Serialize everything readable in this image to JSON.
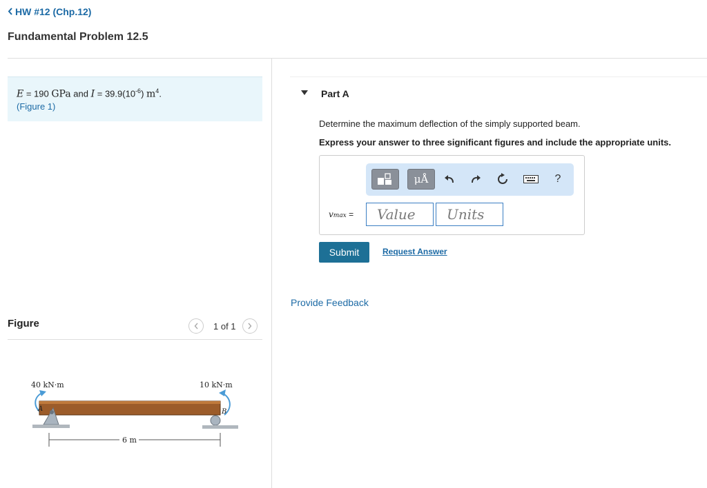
{
  "nav": {
    "back_label": "HW #12 (Chp.12)"
  },
  "page_title": "Fundamental Problem 12.5",
  "given": {
    "E_symbol": "E",
    "eq1": " = 190 ",
    "E_unit": "GPa",
    "and": " and ",
    "I_symbol": "I",
    "eq2": " = 39.9(10",
    "exp1": "-6",
    "close_paren": ") ",
    "I_unit": "m",
    "exp2": "4",
    "period": ".",
    "figure_link": "(Figure 1)"
  },
  "figure_panel": {
    "heading": "Figure",
    "pager_text": "1 of 1",
    "labels": {
      "left_moment": "40 kN·m",
      "right_moment": "10 kN·m",
      "support_a": "A",
      "support_b": "B",
      "span": "6 m"
    }
  },
  "part": {
    "label": "Part A",
    "question": "Determine the maximum deflection of the simply supported beam.",
    "instructions": "Express your answer to three significant figures and include the appropriate units.",
    "variable": "v",
    "variable_sub": "max",
    "equals": " =",
    "value_placeholder": "Value",
    "units_placeholder": "Units",
    "toolbar": {
      "units_button": "μÅ",
      "help_button": "?"
    },
    "submit_label": "Submit",
    "request_label": "Request Answer"
  },
  "feedback_label": "Provide Feedback"
}
